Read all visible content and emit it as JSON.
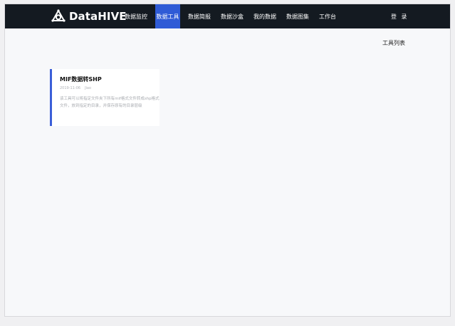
{
  "brand": {
    "name": "DataHIVE",
    "icon": "triangle-hive-logo-icon"
  },
  "nav": {
    "items": [
      {
        "label": "数据监控",
        "active": false
      },
      {
        "label": "数据工具",
        "active": true
      },
      {
        "label": "数据简报",
        "active": false
      },
      {
        "label": "数据沙盒",
        "active": false
      },
      {
        "label": "我的数据",
        "active": false
      },
      {
        "label": "数据图集",
        "active": false
      },
      {
        "label": "工作台",
        "active": false
      }
    ],
    "login_label": "登 录"
  },
  "main": {
    "section_title": "工具列表",
    "cards": [
      {
        "title": "MIF数据转SHP",
        "date": "2019-11-06",
        "author": "Jiao",
        "description": "该工具可以将指定文件夹下所有mif格式文件转成shp格式文件，放到指定的目录，并保存原有的目录层级"
      }
    ]
  },
  "colors": {
    "navbar_bg": "#141a21",
    "accent": "#2f5bd6",
    "page_bg": "#f7f8fa"
  }
}
